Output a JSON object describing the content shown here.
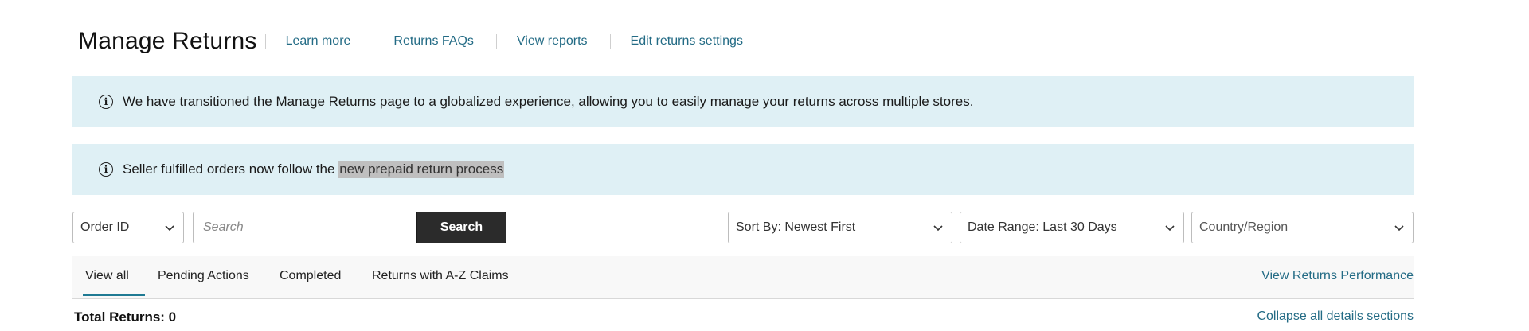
{
  "header": {
    "title": "Manage Returns",
    "links": [
      "Learn more",
      "Returns FAQs",
      "View reports",
      "Edit returns settings"
    ]
  },
  "banners": {
    "global_text": "We have transitioned the Manage Returns page to a globalized experience, allowing you to easily manage your returns across multiple stores.",
    "seller_prefix": "Seller fulfilled orders now follow the ",
    "seller_link": "new prepaid return process"
  },
  "search": {
    "field_select": "Order ID",
    "placeholder": "Search",
    "button": "Search"
  },
  "filters": {
    "sort": "Sort By: Newest First",
    "date_range": "Date Range: Last 30 Days",
    "country": "Country/Region"
  },
  "tabs": [
    "View all",
    "Pending Actions",
    "Completed",
    "Returns with A-Z Claims"
  ],
  "active_tab": "View all",
  "performance_link": "View Returns Performance",
  "total_returns": "Total Returns: 0",
  "collapse_link": "Collapse all details sections",
  "colors": {
    "banner_bg": "#dff0f5",
    "link": "#236b85",
    "search_button": "#2b2b2b",
    "tab_underline": "#1f7a93"
  }
}
